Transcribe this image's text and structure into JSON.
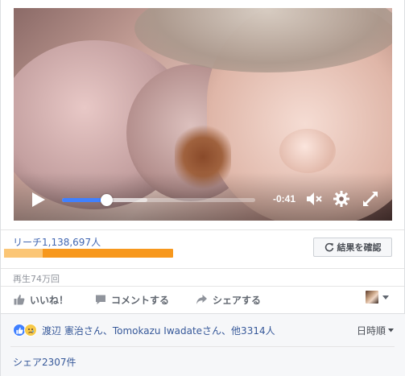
{
  "video": {
    "time_remaining": "-0:41",
    "progress": 0.23,
    "buffered": 0.44
  },
  "insights": {
    "reach_label": "リーチ1,138,697人",
    "organic_fraction": 0.23,
    "boost_button_label": "結果を確認"
  },
  "stats": {
    "views": "再生74万回"
  },
  "actions": {
    "like": "いいね！",
    "comment": "コメントする",
    "share": "シェアする"
  },
  "feedback": {
    "likers_text": "渡辺 憲治さん、Tomokazu Iwadateさん、他3314人",
    "sort_label": "日時順",
    "shares_text": "シェア2307件"
  },
  "colors": {
    "accent": "#4080ff",
    "link": "#365899",
    "paid_reach": "#f7981d",
    "organic_reach": "#fbc676"
  },
  "icons": [
    "play-icon",
    "volume-muted-icon",
    "settings-gear-icon",
    "fullscreen-icon",
    "refresh-icon",
    "thumbs-up-icon",
    "comment-icon",
    "share-arrow-icon",
    "caret-down-icon",
    "like-reaction-icon",
    "sad-reaction-icon"
  ]
}
